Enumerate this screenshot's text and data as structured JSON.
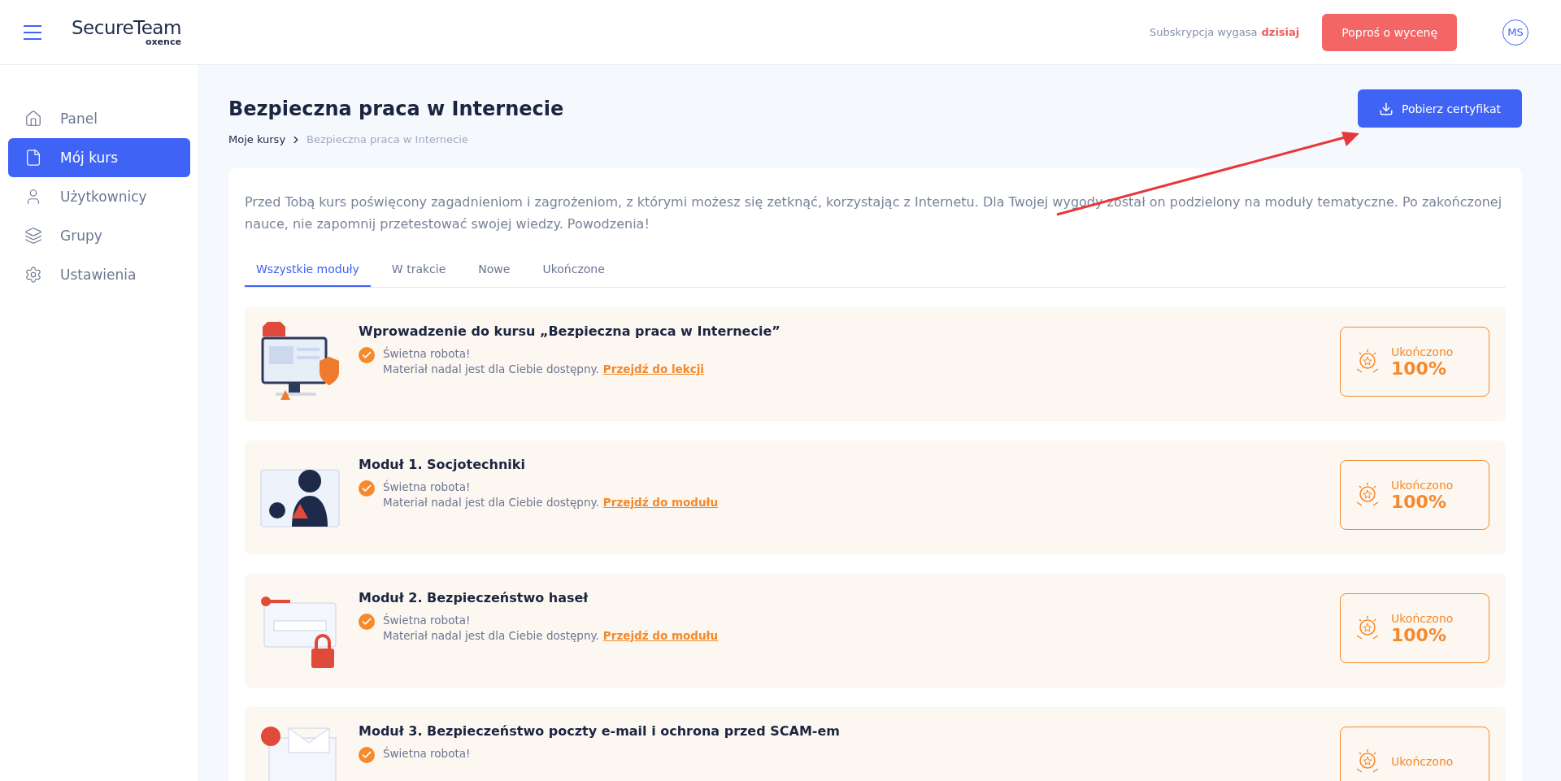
{
  "header": {
    "brand": "SecureTeam",
    "brand_sub": "oxence",
    "subscription_label": "Subskrypcja wygasa",
    "subscription_value": "dzisiaj",
    "quote_button": "Poproś o wycenę",
    "avatar": "MS"
  },
  "sidebar": {
    "items": [
      {
        "label": "Panel",
        "kind": "home",
        "selected": false
      },
      {
        "label": "Mój kurs",
        "kind": "file",
        "selected": true
      },
      {
        "label": "Użytkownicy",
        "kind": "user",
        "selected": false
      },
      {
        "label": "Grupy",
        "kind": "layers",
        "selected": false
      },
      {
        "label": "Ustawienia",
        "kind": "settings",
        "selected": false
      }
    ]
  },
  "page": {
    "title": "Bezpieczna praca w Internecie",
    "certificate_button": "Pobierz certyfikat",
    "breadcrumb": [
      "Moje kursy",
      "Bezpieczna praca w Internecie"
    ]
  },
  "intro": "Przed Tobą kurs poświęcony zagadnieniom i zagrożeniom, z którymi możesz się zetknąć, korzystając z Internetu. Dla Twojej wygody został on podzielony na moduły tematyczne. Po zakończonej nauce, nie zapomnij przetestować swojej wiedzy. Powodzenia!",
  "tabs": [
    {
      "label": "Wszystkie moduły",
      "selected": true
    },
    {
      "label": "W trakcie",
      "selected": false
    },
    {
      "label": "Nowe",
      "selected": false
    },
    {
      "label": "Ukończone",
      "selected": false
    }
  ],
  "modules": [
    {
      "kind": "stop",
      "title": "Wprowadzenie do kursu „Bezpieczna praca w Internecie”",
      "status": "Świetna robota!",
      "note": "Materiał nadal jest dla Ciebie dostępny.",
      "link": "Przejdź do lekcji",
      "badge_label": "Ukończono",
      "badge_value": "100%"
    },
    {
      "kind": "hacker",
      "title": "Moduł 1. Socjotechniki",
      "status": "Świetna robota!",
      "note": "Materiał nadal jest dla Ciebie dostępny.",
      "link": "Przejdź do modułu",
      "badge_label": "Ukończono",
      "badge_value": "100%"
    },
    {
      "kind": "password",
      "title": "Moduł 2. Bezpieczeństwo haseł",
      "status": "Świetna robota!",
      "note": "Materiał nadal jest dla Ciebie dostępny.",
      "link": "Przejdź do modułu",
      "badge_label": "Ukończono",
      "badge_value": "100%"
    },
    {
      "kind": "mail",
      "title": "Moduł 3. Bezpieczeństwo poczty e-mail i ochrona przed SCAM-em",
      "status": "Świetna robota!",
      "badge_label": "Ukończono"
    }
  ]
}
